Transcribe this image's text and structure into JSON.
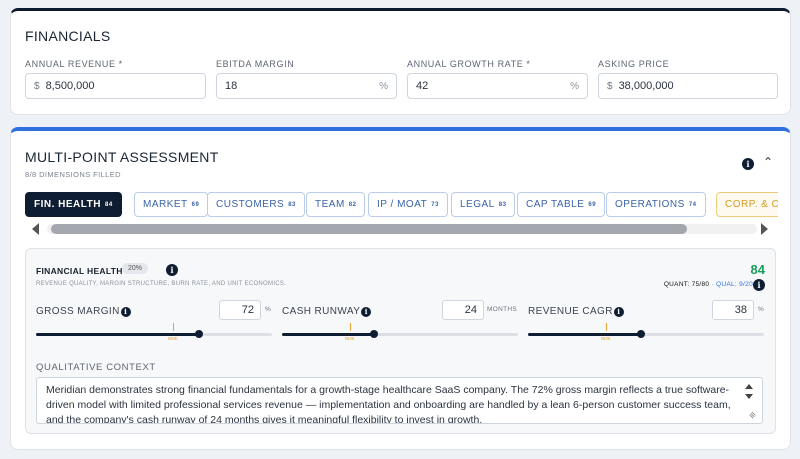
{
  "financials": {
    "title": "FINANCIALS",
    "fields": [
      {
        "label": "ANNUAL REVENUE *",
        "prefix": "$",
        "value": "8,500,000",
        "suffix": ""
      },
      {
        "label": "EBITDA MARGIN",
        "prefix": "",
        "value": "18",
        "suffix": "%"
      },
      {
        "label": "ANNUAL GROWTH RATE *",
        "prefix": "",
        "value": "42",
        "suffix": "%"
      },
      {
        "label": "ASKING PRICE",
        "prefix": "$",
        "value": "38,000,000",
        "suffix": ""
      }
    ]
  },
  "assessment": {
    "title": "MULTI-POINT ASSESSMENT",
    "dimensions_filled": "8/8 DIMENSIONS FILLED",
    "info_glyph": "i",
    "collapse_glyph": "^",
    "tabs": [
      {
        "label": "FIN. HEALTH",
        "score": "84"
      },
      {
        "label": "MARKET",
        "score": "69"
      },
      {
        "label": "CUSTOMERS",
        "score": "83"
      },
      {
        "label": "TEAM",
        "score": "82"
      },
      {
        "label": "IP / MOAT",
        "score": "73"
      },
      {
        "label": "LEGAL",
        "score": "83"
      },
      {
        "label": "CAP TABLE",
        "score": "69"
      },
      {
        "label": "OPERATIONS",
        "score": "74"
      },
      {
        "label": "CORP. & CO",
        "score": ""
      }
    ],
    "panel": {
      "title": "FINANCIAL HEALTH",
      "weight": "20%",
      "subtitle": "REVENUE QUALITY, MARGIN STRUCTURE, BURN RATE, AND UNIT ECONOMICS.",
      "score": "84",
      "quant": "QUANT: 75/80",
      "separator": "·",
      "qual": "QUAL: 9/20",
      "metrics": [
        {
          "label": "GROSS MARGIN",
          "value": "72",
          "unit": "%",
          "fill_fraction": 0.69,
          "benchmark_fraction": 0.58,
          "benchmark_label": "BMK"
        },
        {
          "label": "CASH RUNWAY",
          "value": "24",
          "unit": "MONTHS",
          "fill_fraction": 0.39,
          "benchmark_fraction": 0.29,
          "benchmark_label": "BMK"
        },
        {
          "label": "REVENUE CAGR",
          "value": "38",
          "unit": "%",
          "fill_fraction": 0.48,
          "benchmark_fraction": 0.33,
          "benchmark_label": "BMK"
        }
      ],
      "qualitative_label": "QUALITATIVE CONTEXT",
      "qualitative_text": "Meridian demonstrates strong financial fundamentals for a growth-stage healthcare SaaS company. The 72% gross margin reflects a true software-driven model with limited professional services revenue — implementation and onboarding are handled by a lean 6-person customer success team, and the company's cash runway of 24 months gives it meaningful flexibility to invest in growth."
    }
  },
  "colors": {
    "navy": "#0f1d32",
    "accent_blue": "#2f6fe0",
    "score_green": "#1a9c5b",
    "benchmark_orange": "#e3a33b"
  },
  "icons": [
    "info-icon",
    "chevron-up-icon",
    "scroll-left-icon",
    "scroll-right-icon",
    "resize-grip-icon"
  ]
}
